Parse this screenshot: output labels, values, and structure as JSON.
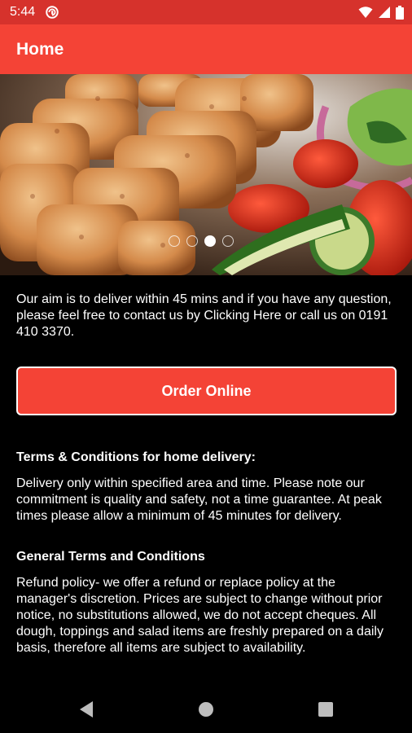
{
  "status_bar": {
    "time": "5:44",
    "icons": [
      "data-saver-icon",
      "wifi-icon",
      "cellular-signal-icon",
      "battery-icon"
    ]
  },
  "app_bar": {
    "title": "Home"
  },
  "carousel": {
    "image": "grilled-chicken-skewers-with-salad",
    "slide_count": 4,
    "active_slide": 3
  },
  "intro": {
    "text": "Our aim is to deliver within 45 mins and if you have any question, please feel free to contact us by Clicking Here or call us on 0191 410 3370."
  },
  "order_button": {
    "label": "Order Online"
  },
  "sections": [
    {
      "heading": "Terms & Conditions for home delivery:",
      "body": "Delivery only within specified area and time. Please note our commitment is quality and safety, not a time guarantee. At peak times please allow a minimum of 45 minutes for delivery."
    },
    {
      "heading": "General Terms and Conditions",
      "body": "Refund policy- we offer a refund or replace policy at the manager's discretion. Prices are subject to change without prior notice, no substitutions allowed, we do not accept cheques. All dough, toppings and salad items are freshly prepared on a daily basis, therefore all items are subject to availability."
    }
  ],
  "nav_bar": {
    "buttons": [
      "back-icon",
      "home-icon",
      "recents-icon"
    ]
  },
  "colors": {
    "accent": "#f44336",
    "status_bar": "#d6322c",
    "background": "#000000"
  }
}
